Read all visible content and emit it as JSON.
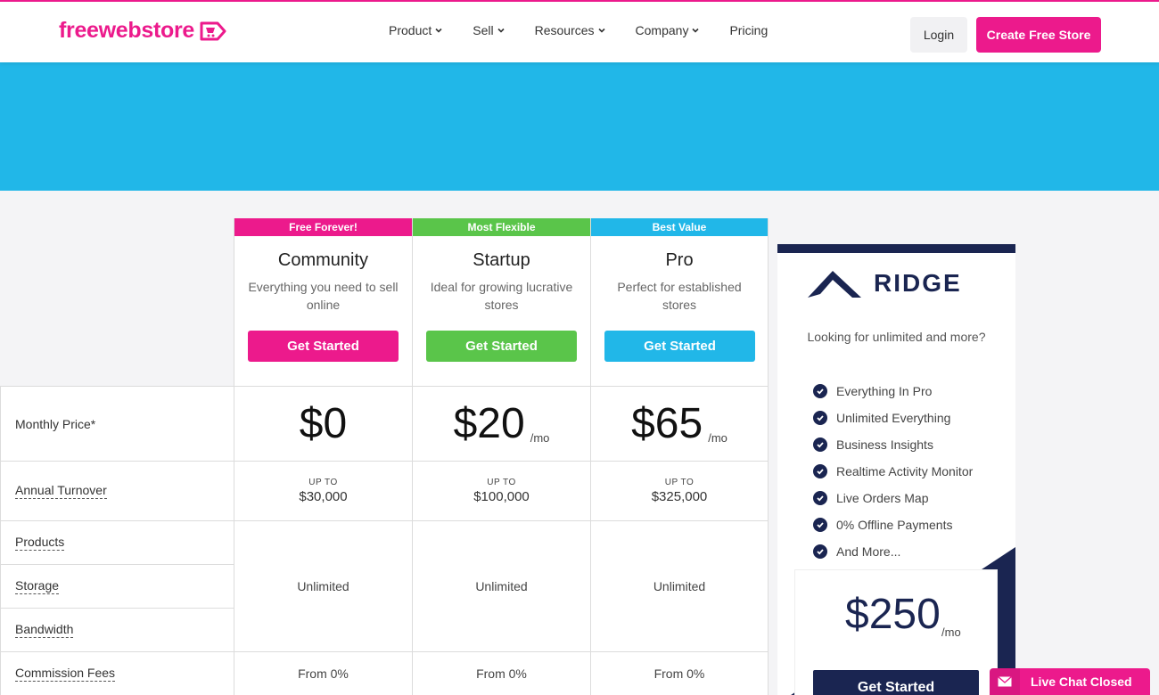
{
  "header": {
    "logo_text": "freewebstore",
    "nav": [
      {
        "label": "Product",
        "dropdown": true
      },
      {
        "label": "Sell",
        "dropdown": true
      },
      {
        "label": "Resources",
        "dropdown": true
      },
      {
        "label": "Company",
        "dropdown": true
      },
      {
        "label": "Pricing",
        "dropdown": false
      }
    ],
    "login_label": "Login",
    "create_label": "Create Free Store"
  },
  "colors": {
    "brand_pink": "#ec1a8c",
    "hero_blue": "#21b7e8",
    "startup_green": "#5ac54a",
    "pro_blue": "#21b7e8",
    "ridge_navy": "#1a2551"
  },
  "plans": [
    {
      "tag": "Free Forever!",
      "name": "Community",
      "desc": "Everything you need to sell online",
      "cta": "Get Started",
      "price": "$0",
      "per": "",
      "upto_label": "UP TO",
      "turnover": "$30,000",
      "unlimited": "Unlimited",
      "commission": "From 0%"
    },
    {
      "tag": "Most Flexible",
      "name": "Startup",
      "desc": "Ideal for growing lucrative stores",
      "cta": "Get Started",
      "price": "$20",
      "per": "/mo",
      "upto_label": "UP TO",
      "turnover": "$100,000",
      "unlimited": "Unlimited",
      "commission": "From 0%"
    },
    {
      "tag": "Best Value",
      "name": "Pro",
      "desc": "Perfect for established stores",
      "cta": "Get Started",
      "price": "$65",
      "per": "/mo",
      "upto_label": "UP TO",
      "turnover": "$325,000",
      "unlimited": "Unlimited",
      "commission": "From 0%"
    }
  ],
  "row_labels": {
    "monthly_price": "Monthly Price*",
    "annual_turnover": "Annual Turnover",
    "products": "Products",
    "storage": "Storage",
    "bandwidth": "Bandwidth",
    "commission_fees": "Commission Fees"
  },
  "ridge": {
    "logo_text": "RIDGE",
    "subtitle": "Looking for unlimited and more?",
    "features": [
      "Everything In Pro",
      "Unlimited Everything",
      "Business Insights",
      "Realtime Activity Monitor",
      "Live Orders Map",
      "0% Offline Payments",
      "And More..."
    ],
    "price": "$250",
    "per": "/mo",
    "cta": "Get Started"
  },
  "chat": {
    "label": "Live Chat Closed"
  }
}
